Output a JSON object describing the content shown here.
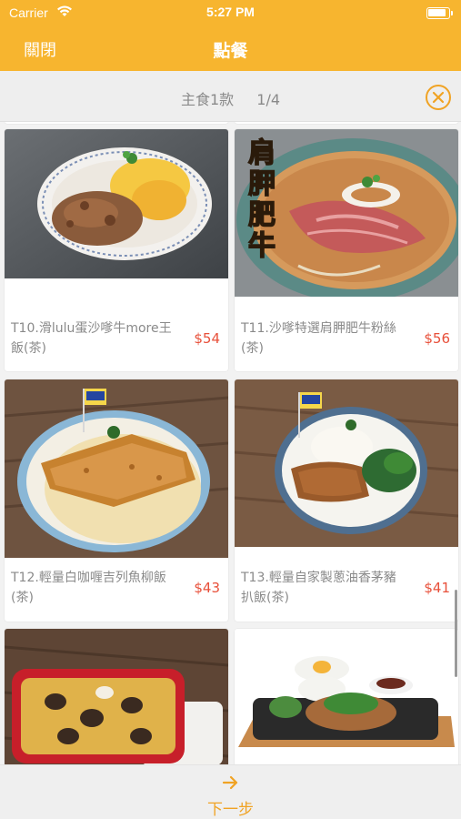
{
  "status": {
    "carrier": "Carrier",
    "time": "5:27 PM"
  },
  "nav": {
    "close_label": "關閉",
    "title": "點餐"
  },
  "subbar": {
    "category": "主食1款",
    "page": "1/4"
  },
  "items": [
    {
      "name": "T10.滑lulu蛋沙嗲牛more王飯(茶)",
      "price": "$54"
    },
    {
      "name": "T11.沙嗲特選肩胛肥牛粉絲(茶)",
      "price": "$56",
      "badge": "肩胛肥牛"
    },
    {
      "name": "T12.輕量白咖喱吉列魚柳飯(茶)",
      "price": "$43"
    },
    {
      "name": "T13.輕量自家製蔥油香茅豬扒飯(茶)",
      "price": "$41"
    }
  ],
  "bottom": {
    "next_label": "下一步"
  },
  "colors": {
    "accent": "#f7b52f",
    "price": "#e8503a",
    "next": "#f0a324"
  },
  "icons": {
    "close": "circle-x-icon",
    "next": "arrow-right-icon"
  }
}
